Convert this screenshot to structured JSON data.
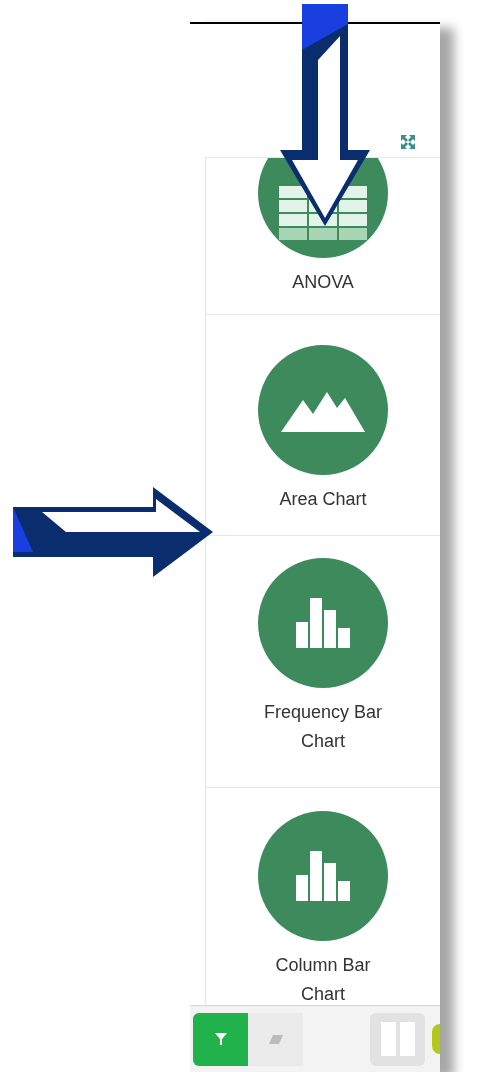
{
  "items": [
    {
      "kind": "table",
      "label": "ANOVA"
    },
    {
      "kind": "area",
      "label": "Area Chart"
    },
    {
      "kind": "bars",
      "label": "Frequency Bar Chart"
    },
    {
      "kind": "bars",
      "label": "Column Bar Chart"
    }
  ],
  "toolbar": [
    {
      "kind": "filter",
      "selected": true
    },
    {
      "kind": "eraser",
      "selected": false
    },
    {
      "kind": "columns",
      "selected": false
    }
  ]
}
